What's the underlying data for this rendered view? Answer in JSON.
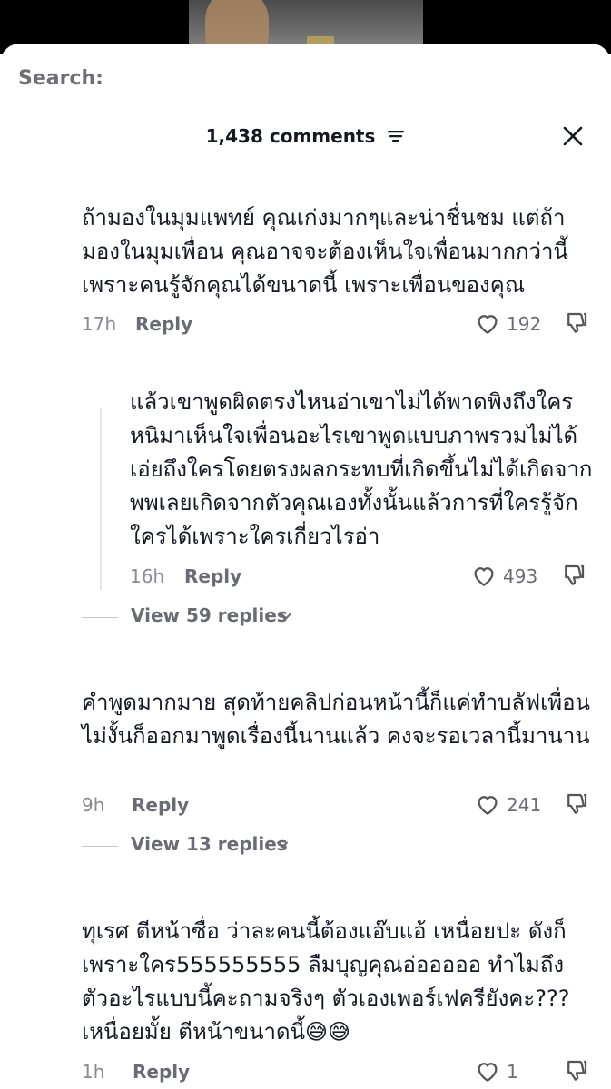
{
  "search": {
    "label": "Search:"
  },
  "header": {
    "comment_count": "1,438 comments"
  },
  "comments": [
    {
      "text": "ถ้ามองในมุมแพทย์ คุณเก่งมากๆและน่าชื่นชม แต่ถ้ามองในมุมเพื่อน คุณอาจจะต้องเห็นใจเพื่อนมากกว่านี้ เพราะคนรู้จักคุณได้ขนาดนี้ เพราะเพื่อนของคุณ",
      "time": "17h",
      "reply_label": "Reply",
      "likes": "192"
    },
    {
      "text": "แล้วเขาพูดผิดตรงไหนอ่าเขาไม่ได้พาดพิงถึงใครหนิมาเห็นใจเพื่อนอะไรเขาพูดแบบภาพรวมไม่ได้เอ่ยถึงใครโดยตรงผลกระทบที่เกิดขึ้นไม่ได้เกิดจากพพเลยเกิดจากตัวคุณเองทั้งนั้นแล้วการที่ใครรู้จักใครได้เพราะใครเกี่ยวไรอ่า",
      "time": "16h",
      "reply_label": "Reply",
      "likes": "493",
      "view_replies": "View 59 replies"
    },
    {
      "text": "คำพูดมากมาย สุดท้ายคลิปก่อนหน้านี้ก็แค่ทำบลัฟเพื่อน ไม่งั้นก็ออกมาพูดเรื่องนี้นานแล้ว คงจะรอเวลานี้มานาน",
      "time": "9h",
      "reply_label": "Reply",
      "likes": "241",
      "view_replies": "View 13 replies"
    },
    {
      "text": "ทุเรศ ตีหน้าซื่อ ว่าละคนนี้ต้องแอ๊บแอ้ เหนื่อยปะ ดังก็เพราะใคร555555555 ลืมบุญคุณอ่อออออ ทำไมถึงตัวอะไรแบบนี้คะถามจริงๆ ตัวเองเพอร์เฟครียังคะ??? เหนื่อยมั้ย ตีหน้าขนาดนี้😅😅",
      "time": "1h",
      "reply_label": "Reply",
      "likes": "1"
    }
  ]
}
